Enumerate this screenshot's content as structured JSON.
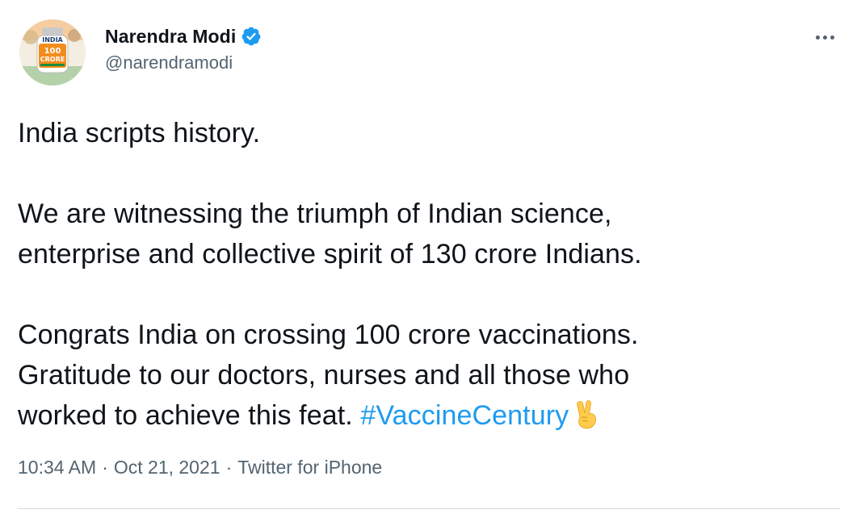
{
  "author": {
    "name": "Narendra Modi",
    "handle": "@narendramodi",
    "verified": true,
    "avatar_badge": {
      "line1": "INDIA",
      "line2": "100",
      "line3": "CRORE"
    }
  },
  "menu": {
    "icon": "more-horizontal-icon"
  },
  "tweet": {
    "lines": [
      "India scripts history.",
      "",
      "We are witnessing the triumph of Indian science,",
      "enterprise and collective spirit of 130 crore Indians.",
      "",
      "Congrats India on crossing 100 crore vaccinations.",
      "Gratitude to our doctors, nurses and all those who",
      "worked to achieve this feat. "
    ],
    "hashtag": "#VaccineCentury",
    "emoji": "victory-hand-emoji"
  },
  "meta": {
    "time": "10:34 AM",
    "date": "Oct 21, 2021",
    "source": "Twitter for iPhone",
    "separator": "·"
  },
  "colors": {
    "text": "#0f1419",
    "secondary": "#536471",
    "link": "#1d9bf0",
    "divider": "#cfd9de"
  }
}
